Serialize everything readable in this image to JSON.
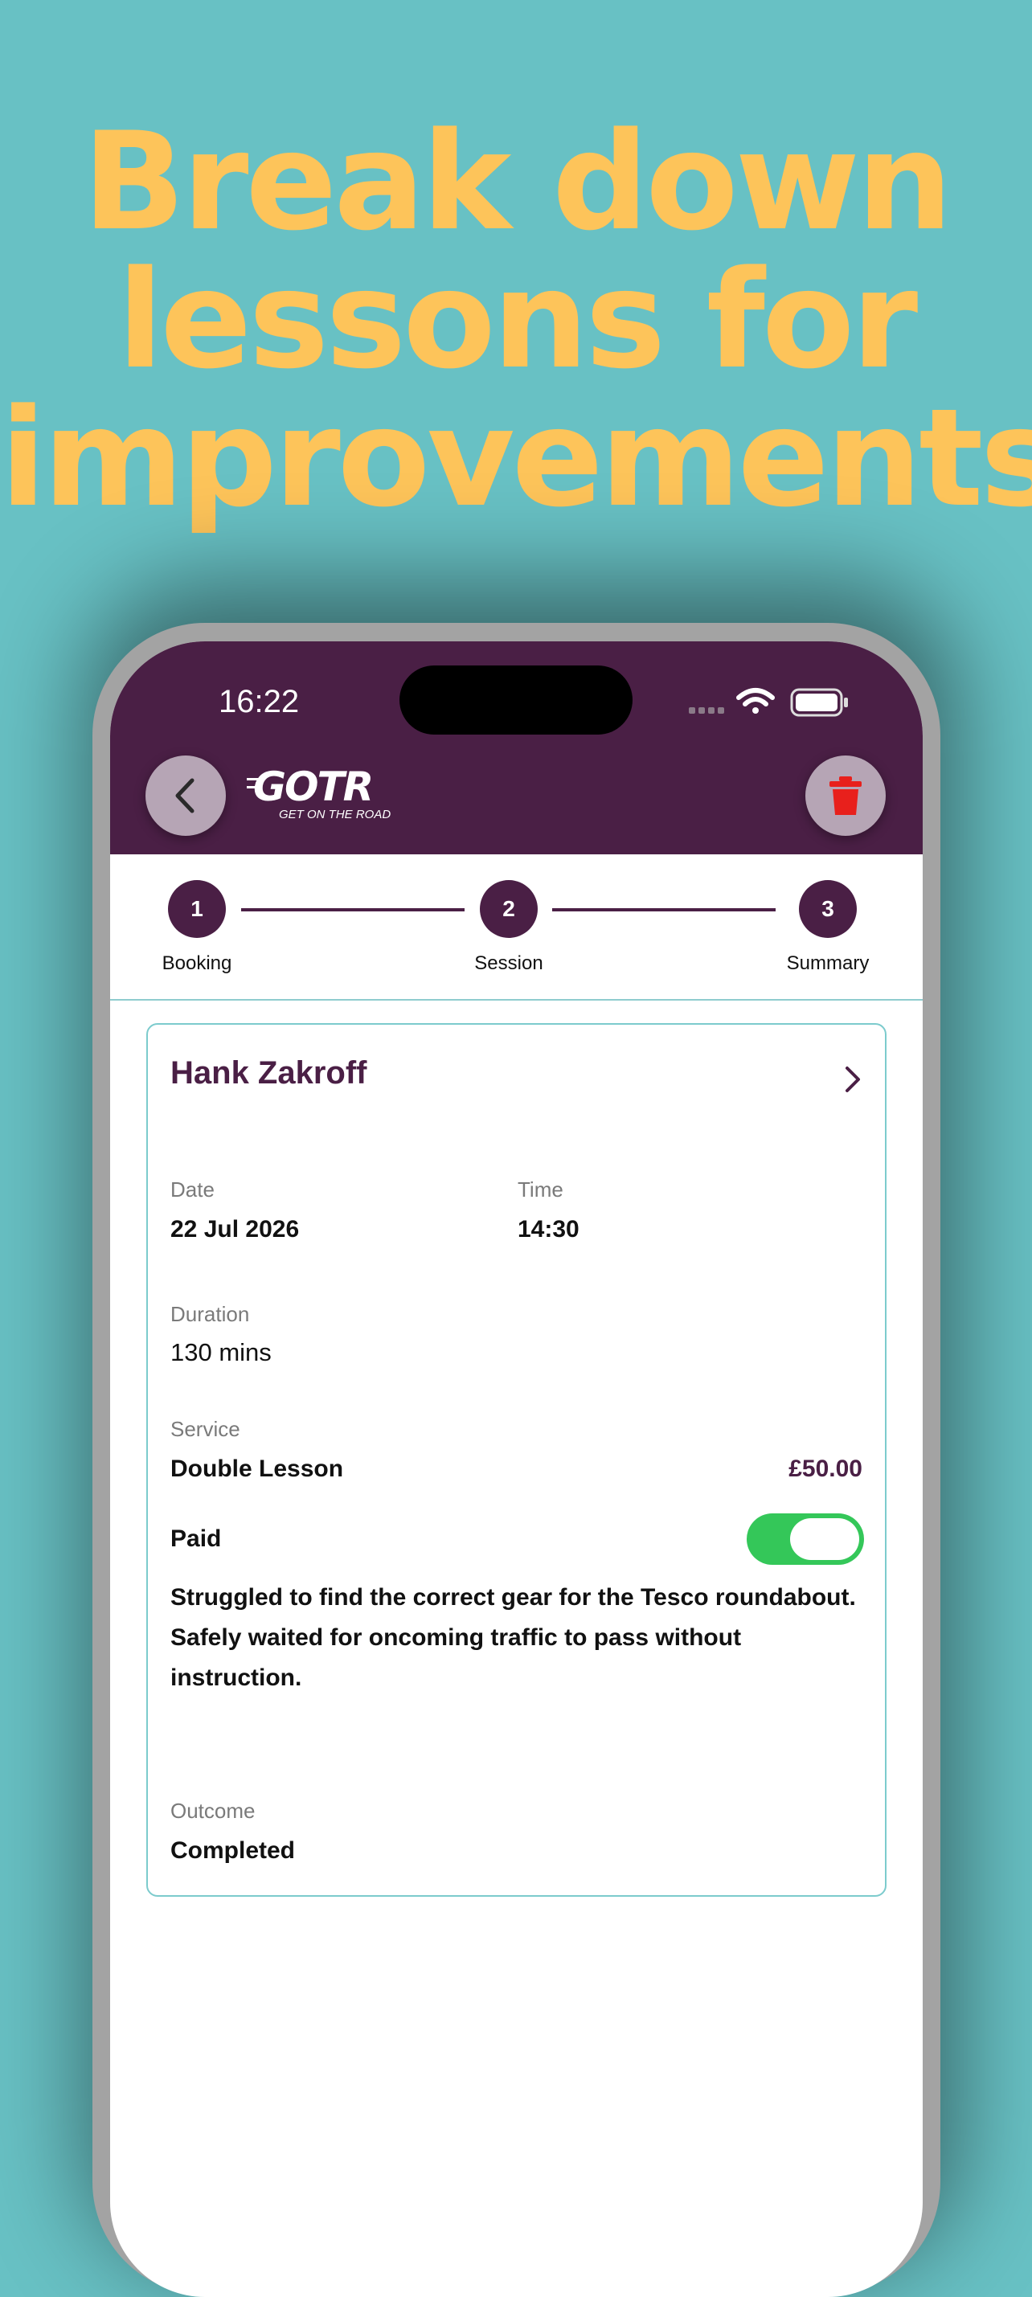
{
  "promo": {
    "headline_lines": [
      "Break down",
      "lessons for",
      "improvements"
    ]
  },
  "status_bar": {
    "time": "16:22"
  },
  "header": {
    "logo_text": "GOTR",
    "logo_tagline": "GET ON THE ROAD",
    "back_icon": "chevron-left-icon",
    "delete_icon": "trash-icon"
  },
  "stepper": {
    "steps": [
      {
        "number": "1",
        "label": "Booking"
      },
      {
        "number": "2",
        "label": "Session"
      },
      {
        "number": "3",
        "label": "Summary"
      }
    ]
  },
  "lesson": {
    "client_name": "Hank Zakroff",
    "date_label": "Date",
    "date_value": "22 Jul 2026",
    "time_label": "Time",
    "time_value": "14:30",
    "duration_label": "Duration",
    "duration_value": "130 mins",
    "service_label": "Service",
    "service_value": "Double Lesson",
    "price": "£50.00",
    "paid_label": "Paid",
    "paid": true,
    "notes": [
      "Struggled to find the correct gear for the Tesco roundabout.",
      "Safely waited for oncoming traffic to pass without instruction."
    ],
    "outcome_label": "Outcome",
    "outcome_value": "Completed"
  },
  "colors": {
    "background": "#68c1c4",
    "headline": "#fdc45a",
    "brand": "#4a1f45",
    "toggle_on": "#34c759",
    "delete": "#e8201c",
    "card_border": "#7ccbcd"
  }
}
